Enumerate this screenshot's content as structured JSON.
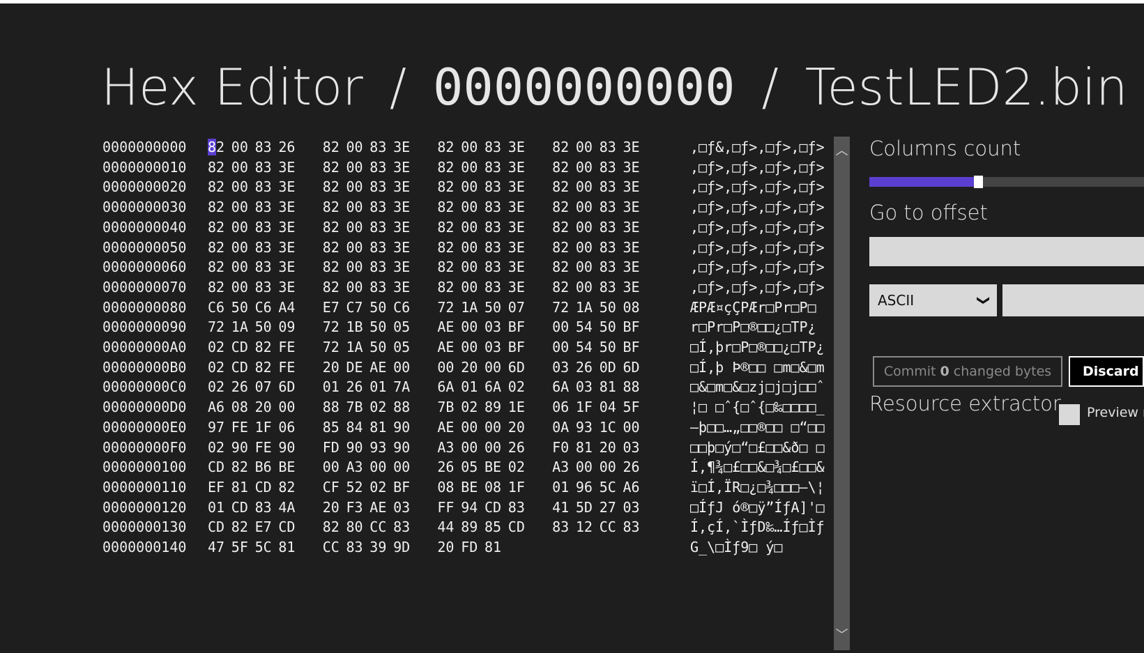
{
  "header": {
    "app_title": "Hex Editor",
    "separator": "/",
    "current_offset": "0000000000",
    "file_name": "TestLED2.bin"
  },
  "hex_rows": [
    {
      "addr": "0000000000",
      "bytes": [
        "82",
        "00",
        "83",
        "26",
        "82",
        "00",
        "83",
        "3E",
        "82",
        "00",
        "83",
        "3E",
        "82",
        "00",
        "83",
        "3E"
      ],
      "ascii": ",□ƒ&,□ƒ>,□ƒ>,□ƒ>"
    },
    {
      "addr": "0000000010",
      "bytes": [
        "82",
        "00",
        "83",
        "3E",
        "82",
        "00",
        "83",
        "3E",
        "82",
        "00",
        "83",
        "3E",
        "82",
        "00",
        "83",
        "3E"
      ],
      "ascii": ",□ƒ>,□ƒ>,□ƒ>,□ƒ>"
    },
    {
      "addr": "0000000020",
      "bytes": [
        "82",
        "00",
        "83",
        "3E",
        "82",
        "00",
        "83",
        "3E",
        "82",
        "00",
        "83",
        "3E",
        "82",
        "00",
        "83",
        "3E"
      ],
      "ascii": ",□ƒ>,□ƒ>,□ƒ>,□ƒ>"
    },
    {
      "addr": "0000000030",
      "bytes": [
        "82",
        "00",
        "83",
        "3E",
        "82",
        "00",
        "83",
        "3E",
        "82",
        "00",
        "83",
        "3E",
        "82",
        "00",
        "83",
        "3E"
      ],
      "ascii": ",□ƒ>,□ƒ>,□ƒ>,□ƒ>"
    },
    {
      "addr": "0000000040",
      "bytes": [
        "82",
        "00",
        "83",
        "3E",
        "82",
        "00",
        "83",
        "3E",
        "82",
        "00",
        "83",
        "3E",
        "82",
        "00",
        "83",
        "3E"
      ],
      "ascii": ",□ƒ>,□ƒ>,□ƒ>,□ƒ>"
    },
    {
      "addr": "0000000050",
      "bytes": [
        "82",
        "00",
        "83",
        "3E",
        "82",
        "00",
        "83",
        "3E",
        "82",
        "00",
        "83",
        "3E",
        "82",
        "00",
        "83",
        "3E"
      ],
      "ascii": ",□ƒ>,□ƒ>,□ƒ>,□ƒ>"
    },
    {
      "addr": "0000000060",
      "bytes": [
        "82",
        "00",
        "83",
        "3E",
        "82",
        "00",
        "83",
        "3E",
        "82",
        "00",
        "83",
        "3E",
        "82",
        "00",
        "83",
        "3E"
      ],
      "ascii": ",□ƒ>,□ƒ>,□ƒ>,□ƒ>"
    },
    {
      "addr": "0000000070",
      "bytes": [
        "82",
        "00",
        "83",
        "3E",
        "82",
        "00",
        "83",
        "3E",
        "82",
        "00",
        "83",
        "3E",
        "82",
        "00",
        "83",
        "3E"
      ],
      "ascii": ",□ƒ>,□ƒ>,□ƒ>,□ƒ>"
    },
    {
      "addr": "0000000080",
      "bytes": [
        "C6",
        "50",
        "C6",
        "A4",
        "E7",
        "C7",
        "50",
        "C6",
        "72",
        "1A",
        "50",
        "07",
        "72",
        "1A",
        "50",
        "08"
      ],
      "ascii": "ÆPÆ¤çÇPÆr□Pr□P□"
    },
    {
      "addr": "0000000090",
      "bytes": [
        "72",
        "1A",
        "50",
        "09",
        "72",
        "1B",
        "50",
        "05",
        "AE",
        "00",
        "03",
        "BF",
        "00",
        "54",
        "50",
        "BF"
      ],
      "ascii": "r□Pr□P□®□□¿□TP¿"
    },
    {
      "addr": "00000000A0",
      "bytes": [
        "02",
        "CD",
        "82",
        "FE",
        "72",
        "1A",
        "50",
        "05",
        "AE",
        "00",
        "03",
        "BF",
        "00",
        "54",
        "50",
        "BF"
      ],
      "ascii": "□Í‚þr□P□®□□¿□TP¿"
    },
    {
      "addr": "00000000B0",
      "bytes": [
        "02",
        "CD",
        "82",
        "FE",
        "20",
        "DE",
        "AE",
        "00",
        "00",
        "20",
        "00",
        "6D",
        "03",
        "26",
        "0D",
        "6D"
      ],
      "ascii": "□Í‚þ Þ®□□ □m□&□m"
    },
    {
      "addr": "00000000C0",
      "bytes": [
        "02",
        "26",
        "07",
        "6D",
        "01",
        "26",
        "01",
        "7A",
        "6A",
        "01",
        "6A",
        "02",
        "6A",
        "03",
        "81",
        "88"
      ],
      "ascii": "□&□m□&□zj□j□j□□ˆ"
    },
    {
      "addr": "00000000D0",
      "bytes": [
        "A6",
        "08",
        "20",
        "00",
        "88",
        "7B",
        "02",
        "88",
        "7B",
        "02",
        "89",
        "1E",
        "06",
        "1F",
        "04",
        "5F"
      ],
      "ascii": "¦□ □ˆ{□ˆ{□‰□□□□_"
    },
    {
      "addr": "00000000E0",
      "bytes": [
        "97",
        "FE",
        "1F",
        "06",
        "85",
        "84",
        "81",
        "90",
        "AE",
        "00",
        "00",
        "20",
        "0A",
        "93",
        "1C",
        "00"
      ],
      "ascii": "—þ□□…„□□®□□ □“□□"
    },
    {
      "addr": "00000000F0",
      "bytes": [
        "02",
        "90",
        "FE",
        "90",
        "FD",
        "90",
        "93",
        "90",
        "A3",
        "00",
        "00",
        "26",
        "F0",
        "81",
        "20",
        "03"
      ],
      "ascii": "□□þ□ý□“□£□□&ð□ □"
    },
    {
      "addr": "0000000100",
      "bytes": [
        "CD",
        "82",
        "B6",
        "BE",
        "00",
        "A3",
        "00",
        "00",
        "26",
        "05",
        "BE",
        "02",
        "A3",
        "00",
        "00",
        "26"
      ],
      "ascii": "Í‚¶¾□£□□&□¾□£□□&"
    },
    {
      "addr": "0000000110",
      "bytes": [
        "EF",
        "81",
        "CD",
        "82",
        "CF",
        "52",
        "02",
        "BF",
        "08",
        "BE",
        "08",
        "1F",
        "01",
        "96",
        "5C",
        "A6"
      ],
      "ascii": "ï□Í‚ÏR□¿□¾□□□–\\¦"
    },
    {
      "addr": "0000000120",
      "bytes": [
        "01",
        "CD",
        "83",
        "4A",
        "20",
        "F3",
        "AE",
        "03",
        "FF",
        "94",
        "CD",
        "83",
        "41",
        "5D",
        "27",
        "03"
      ],
      "ascii": "□ÍƒJ ó®□ÿ”ÍƒA]'□"
    },
    {
      "addr": "0000000130",
      "bytes": [
        "CD",
        "82",
        "E7",
        "CD",
        "82",
        "80",
        "CC",
        "83",
        "44",
        "89",
        "85",
        "CD",
        "83",
        "12",
        "CC",
        "83"
      ],
      "ascii": "Í‚çÍ‚`ÌƒD‰…Íƒ□Ìƒ"
    },
    {
      "addr": "0000000140",
      "bytes": [
        "47",
        "5F",
        "5C",
        "81",
        "CC",
        "83",
        "39",
        "9D",
        "20",
        "FD",
        "81"
      ],
      "ascii": "G_\\□Ìƒ9□ ý□"
    }
  ],
  "scrollbar": {
    "up_glyph": "︿",
    "down_glyph": "﹀"
  },
  "panel": {
    "columns_label": "Columns count",
    "columns_fraction": 0.38,
    "goto_label": "Go to offset",
    "goto_value": "",
    "encoding_selected": "ASCII",
    "encoding_chevron": "❯",
    "search_value": "",
    "commit_prefix": "Commit ",
    "commit_count": "0",
    "commit_suffix": " changed bytes",
    "discard_label": "Discard",
    "resource_label": "Resource extractor",
    "preview_label": "Preview m"
  },
  "colors": {
    "accent": "#5b3fd0",
    "background": "#1e1e1e"
  }
}
